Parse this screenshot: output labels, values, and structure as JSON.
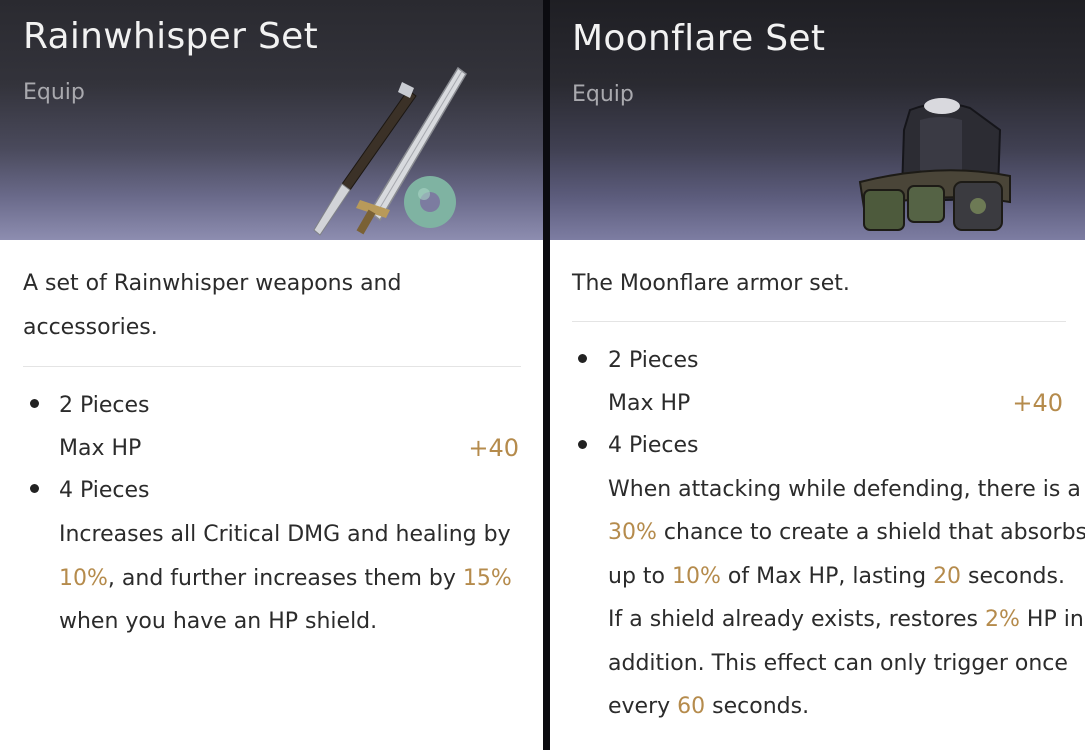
{
  "cards": [
    {
      "title": "Rainwhisper Set",
      "category": "Equip",
      "description": "A set of Rainwhisper weapons and accessories.",
      "desc_lines": [
        "A set of Rainwhisper weapons and",
        "accessories."
      ],
      "bonuses": [
        {
          "pieces": "2 Pieces",
          "stat_name": "Max HP",
          "stat_value": "+40"
        },
        {
          "pieces": "4 Pieces",
          "effect_lines": [
            [
              {
                "t": "Increases all Critical DMG and healing by"
              }
            ],
            [
              {
                "t": "10%",
                "hl": true
              },
              {
                "t": ", and further increases them by "
              },
              {
                "t": "15%",
                "hl": true
              }
            ],
            [
              {
                "t": "when you have an HP shield."
              }
            ]
          ]
        }
      ]
    },
    {
      "title": "Moonflare Set",
      "category": "Equip",
      "description": "The Moonflare armor set.",
      "desc_lines": [
        "The Moonflare armor set."
      ],
      "bonuses": [
        {
          "pieces": "2 Pieces",
          "stat_name": "Max HP",
          "stat_value": "+40"
        },
        {
          "pieces": "4 Pieces",
          "effect_lines": [
            [
              {
                "t": "When attacking while defending, there is a"
              }
            ],
            [
              {
                "t": "30%",
                "hl": true
              },
              {
                "t": " chance to create a shield that absorbs"
              }
            ],
            [
              {
                "t": "up to "
              },
              {
                "t": "10%",
                "hl": true
              },
              {
                "t": " of Max HP, lasting "
              },
              {
                "t": "20",
                "hl": true
              },
              {
                "t": " seconds."
              }
            ],
            [
              {
                "t": "If a shield already exists, restores "
              },
              {
                "t": "2%",
                "hl": true
              },
              {
                "t": " HP in"
              }
            ],
            [
              {
                "t": "addition. This effect can only trigger once"
              }
            ],
            [
              {
                "t": "every "
              },
              {
                "t": "60",
                "hl": true
              },
              {
                "t": " seconds."
              }
            ]
          ]
        }
      ]
    }
  ],
  "icons": {
    "left_card_art": "sword-and-jade-ring-icon",
    "right_card_art": "armor-chestplate-icon"
  },
  "colors": {
    "highlight": "#b58b4c",
    "text": "#2b2b2b",
    "title": "#f2f2f2",
    "subtitle": "#a9a9ae"
  }
}
